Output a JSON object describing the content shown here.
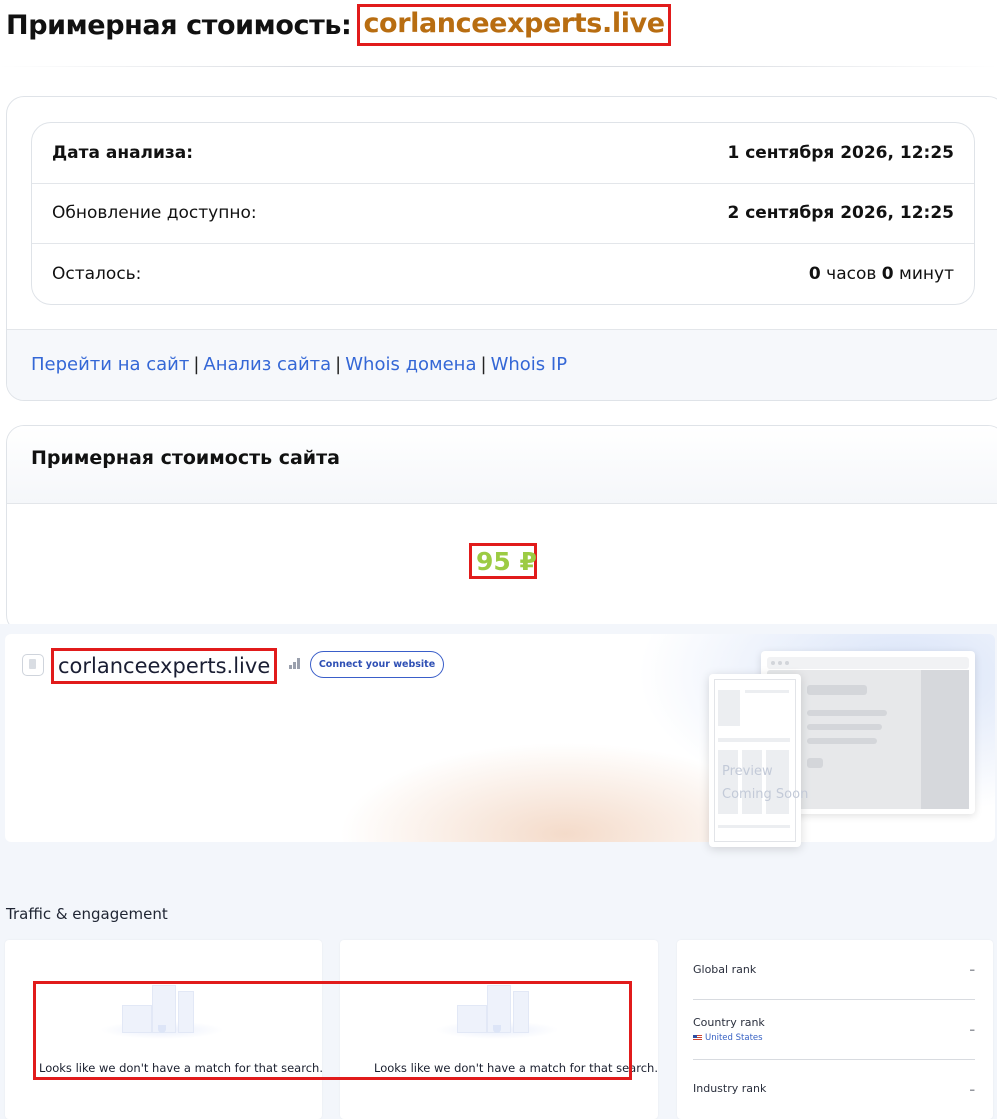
{
  "header": {
    "title_prefix": "Примерная стоимость:",
    "domain": "corlanceexperts.live"
  },
  "analysis": {
    "rows": [
      {
        "label": "Дата анализа:",
        "value": "1 сентября 2026, 12:25"
      },
      {
        "label": "Обновление доступно:",
        "value": "2 сентября 2026, 12:25"
      },
      {
        "label": "Осталось:",
        "hours_num": "0",
        "hours_unit": "часов",
        "minutes_num": "0",
        "minutes_unit": "минут"
      }
    ],
    "links": [
      "Перейти на сайт",
      "Анализ сайта",
      "Whois домена",
      "Whois IP"
    ],
    "separator": "|"
  },
  "estimate": {
    "title": "Примерная стоимость сайта",
    "price": "95 ₽"
  },
  "similarweb": {
    "domain": "corlanceexperts.live",
    "connect_label": "Connect your website",
    "preview_line1": "Preview",
    "preview_line2": "Coming Soon",
    "section_title": "Traffic & engagement",
    "no_match_text": "Looks like we don't have a match for that search.",
    "ranks": [
      {
        "label": "Global rank",
        "value": "–"
      },
      {
        "label": "Country rank",
        "value": "–",
        "sub": "United States"
      },
      {
        "label": "Industry rank",
        "value": "–"
      }
    ]
  },
  "colors": {
    "domain_title": "#b86d11",
    "link": "#3467d6",
    "price": "#9ccb43",
    "highlight_border": "#e11b1b",
    "connect_button": "#2e4fb4"
  }
}
